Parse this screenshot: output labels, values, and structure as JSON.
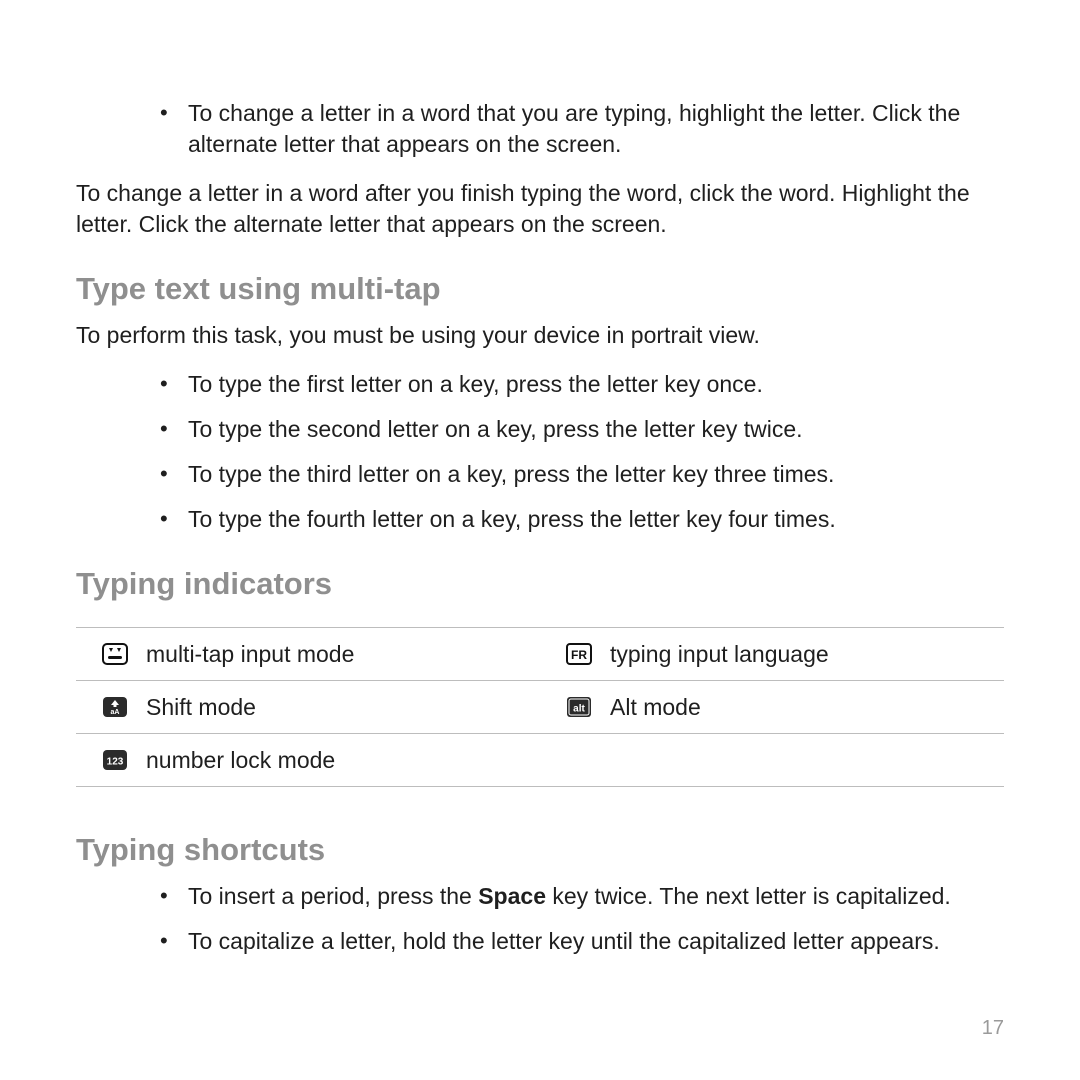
{
  "intro_bullets": [
    "To change a letter in a word that you are typing, highlight the letter. Click the alternate letter that appears on the screen."
  ],
  "intro_para": "To change a letter in a word after you finish typing the word, click the word. Highlight the letter. Click the alternate letter that appears on the screen.",
  "sections": {
    "multitap": {
      "heading": "Type text using multi-tap",
      "lead": "To perform this task, you must be using your device in portrait view.",
      "bullets": [
        "To type the first letter on a key, press the letter key once.",
        "To type the second letter on a key, press the letter key twice.",
        "To type the third letter on a key, press the letter key three times.",
        "To type the fourth letter on a key, press the letter key four times."
      ]
    },
    "indicators": {
      "heading": "Typing indicators",
      "rows": [
        [
          {
            "icon": "multitap-icon",
            "label": "multi-tap input mode"
          },
          {
            "icon": "lang-fr-icon",
            "label": "typing input language"
          }
        ],
        [
          {
            "icon": "shift-icon",
            "label": "Shift mode"
          },
          {
            "icon": "alt-icon",
            "label": "Alt mode"
          }
        ],
        [
          {
            "icon": "numlock-icon",
            "label": "number lock mode"
          },
          null
        ]
      ]
    },
    "shortcuts": {
      "heading": "Typing shortcuts",
      "bullets": [
        {
          "pre": "To insert a period, press the ",
          "bold": "Space",
          "post": " key twice. The next letter is capitalized."
        },
        {
          "pre": "To capitalize a letter, hold the letter key until the capitalized letter appears.",
          "bold": "",
          "post": ""
        }
      ]
    }
  },
  "page_number": "17"
}
